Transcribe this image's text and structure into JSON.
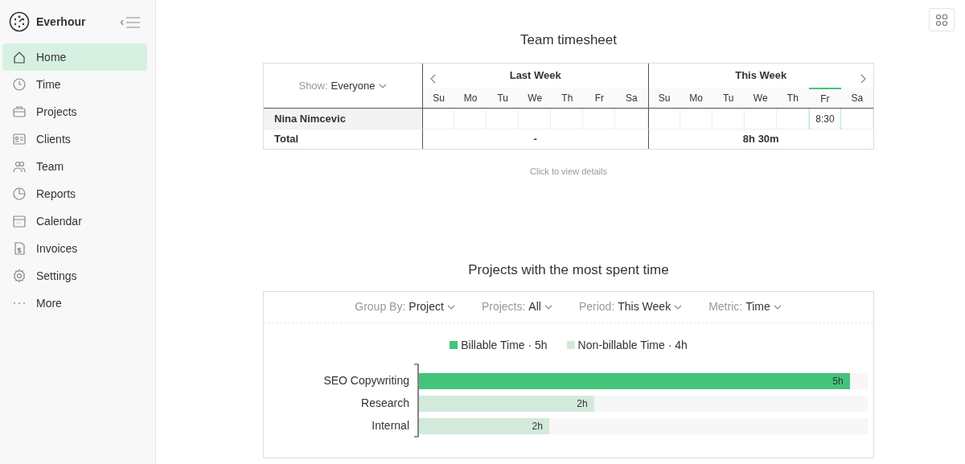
{
  "app": {
    "name": "Everhour"
  },
  "sidebar": {
    "items": [
      {
        "label": "Home",
        "selected": true
      },
      {
        "label": "Time",
        "selected": false
      },
      {
        "label": "Projects",
        "selected": false
      },
      {
        "label": "Clients",
        "selected": false
      },
      {
        "label": "Team",
        "selected": false
      },
      {
        "label": "Reports",
        "selected": false
      },
      {
        "label": "Calendar",
        "selected": false
      },
      {
        "label": "Invoices",
        "selected": false
      },
      {
        "label": "Settings",
        "selected": false
      },
      {
        "label": "More",
        "selected": false
      }
    ]
  },
  "timesheet": {
    "title": "Team timesheet",
    "filter": {
      "label": "Show:",
      "value": "Everyone"
    },
    "weeks": [
      {
        "title": "Last Week",
        "total": "-",
        "days": [
          {
            "label": "Su",
            "selected": false
          },
          {
            "label": "Mo",
            "selected": false
          },
          {
            "label": "Tu",
            "selected": false
          },
          {
            "label": "We",
            "selected": false
          },
          {
            "label": "Th",
            "selected": false
          },
          {
            "label": "Fr",
            "selected": false
          },
          {
            "label": "Sa",
            "selected": false
          }
        ]
      },
      {
        "title": "This Week",
        "total": "8h 30m",
        "days": [
          {
            "label": "Su",
            "selected": false
          },
          {
            "label": "Mo",
            "selected": false
          },
          {
            "label": "Tu",
            "selected": false
          },
          {
            "label": "We",
            "selected": false
          },
          {
            "label": "Th",
            "selected": false
          },
          {
            "label": "Fr",
            "selected": true,
            "entry": "8:30"
          },
          {
            "label": "Sa",
            "selected": false
          }
        ]
      }
    ],
    "member": "Nina Nimcevic",
    "total_label": "Total",
    "hint": "Click to view details"
  },
  "projects_chart": {
    "title": "Projects with the most spent time",
    "filters": [
      {
        "label": "Group By:",
        "value": "Project"
      },
      {
        "label": "Projects:",
        "value": "All"
      },
      {
        "label": "Period:",
        "value": "This Week"
      },
      {
        "label": "Metric:",
        "value": "Time"
      }
    ],
    "legend": [
      {
        "label": "Billable Time · 5h",
        "color": "#44c47b"
      },
      {
        "label": "Non-billable Time · 4h",
        "color": "#d3eadb"
      }
    ],
    "bars": [
      {
        "label": "SEO Copywriting",
        "value": "5h",
        "level": 0.96,
        "color": "#44c47b"
      },
      {
        "label": "Research",
        "value": "2h",
        "level": 0.39,
        "color": "#d3eadb"
      },
      {
        "label": "Internal",
        "value": "2h",
        "level": 0.29,
        "color": "#d3eadb"
      }
    ]
  }
}
